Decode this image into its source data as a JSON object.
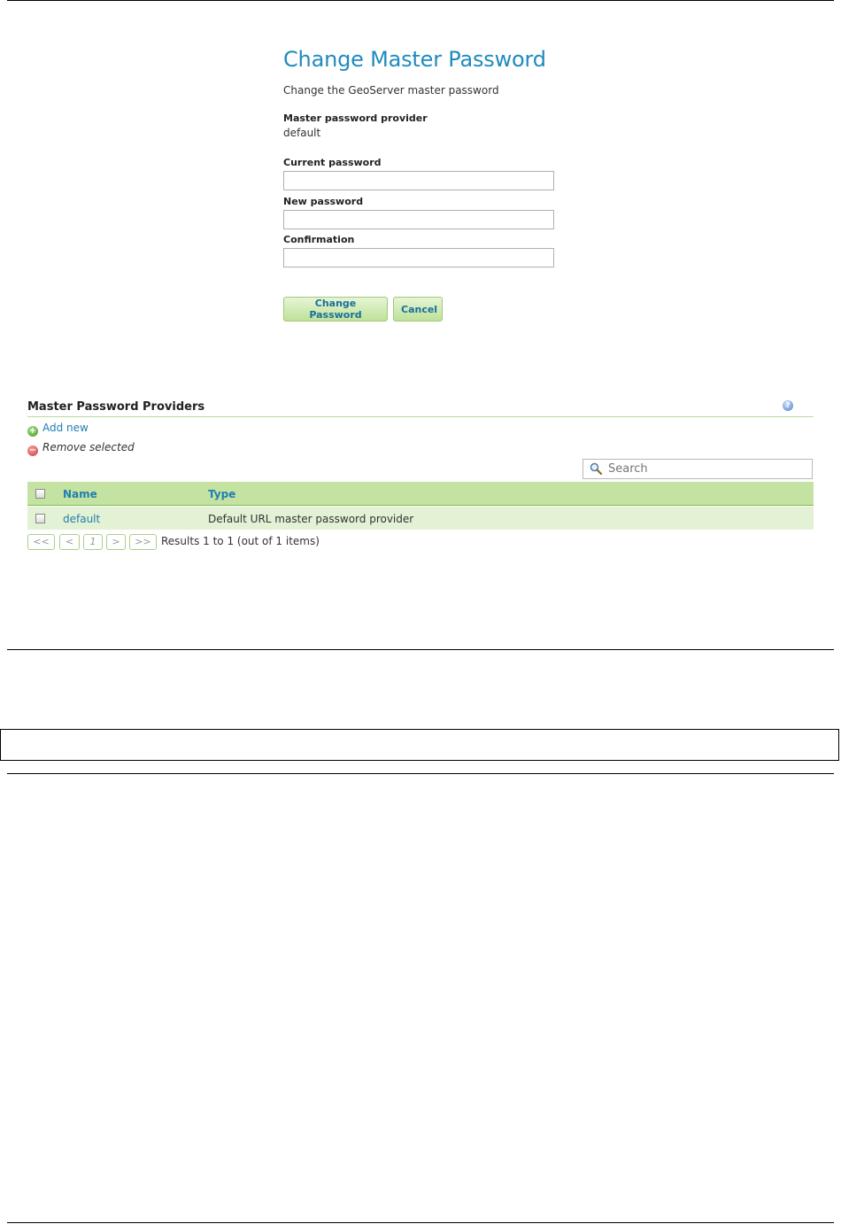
{
  "form": {
    "title": "Change Master Password",
    "subtitle": "Change the GeoServer master password",
    "provider_label": "Master password provider",
    "provider_value": "default",
    "current_label": "Current password",
    "current_value": "",
    "new_label": "New password",
    "new_value": "",
    "confirm_label": "Confirmation",
    "confirm_value": "",
    "change_button": "Change Password",
    "cancel_button": "Cancel"
  },
  "providers": {
    "title": "Master Password Providers",
    "help_icon": "help-icon",
    "add_new": "Add new",
    "remove_selected": "Remove selected",
    "search_placeholder": "Search",
    "columns": {
      "name": "Name",
      "type": "Type"
    },
    "rows": [
      {
        "name": "default",
        "type": "Default URL master password provider",
        "checked": false
      }
    ],
    "pager": {
      "first": "<<",
      "prev": "<",
      "page": "1",
      "next": ">",
      "last": ">>",
      "results": "Results 1 to 1 (out of 1 items)"
    }
  },
  "colors": {
    "title_blue": "#1f8bbd",
    "link_blue": "#1f7fb0",
    "table_header_green": "#c4e3a2",
    "table_row_green": "#e3f1d4",
    "button_green": "#bfe19a"
  }
}
